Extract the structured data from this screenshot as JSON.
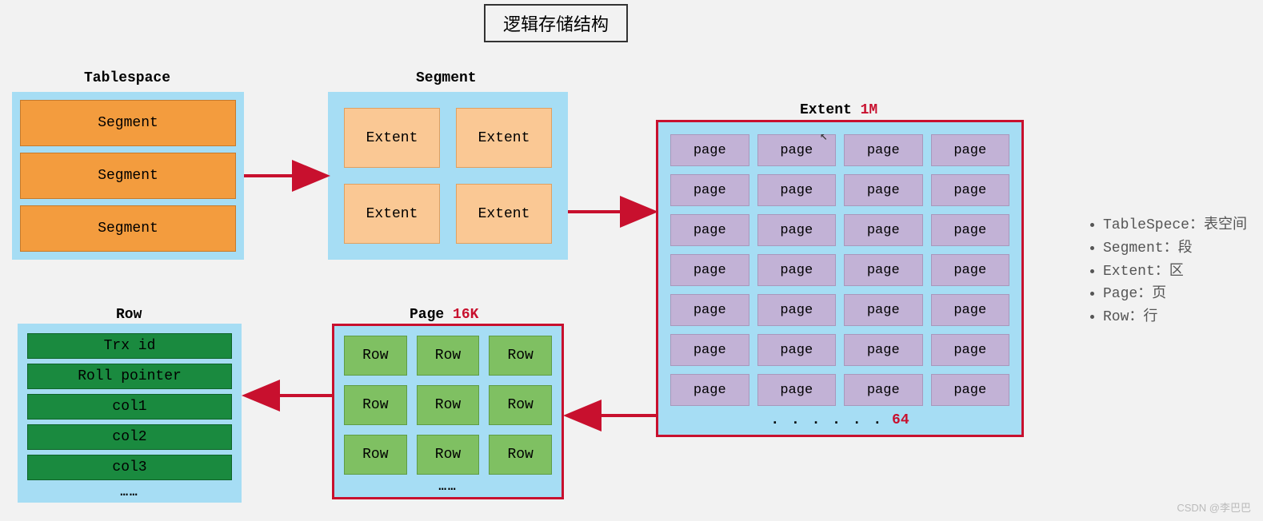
{
  "title": "逻辑存储结构",
  "tablespace": {
    "label": "Tablespace",
    "items": [
      "Segment",
      "Segment",
      "Segment"
    ]
  },
  "segment": {
    "label": "Segment",
    "items": [
      "Extent",
      "Extent",
      "Extent",
      "Extent"
    ]
  },
  "extent": {
    "label": "Extent",
    "size": "1M",
    "page_label": "page",
    "page_rows": 7,
    "page_cols": 4,
    "footer_count": "64"
  },
  "page": {
    "label": "Page",
    "size": "16K",
    "row_label": "Row",
    "rows": 3,
    "cols": 3
  },
  "row": {
    "label": "Row",
    "fields": [
      "Trx id",
      "Roll pointer",
      "col1",
      "col2",
      "col3"
    ]
  },
  "legend": [
    "TableSpece：表空间",
    "Segment：段",
    "Extent：区",
    "Page：页",
    "Row：行"
  ],
  "watermark": "CSDN @李巴巴",
  "dots": "……"
}
